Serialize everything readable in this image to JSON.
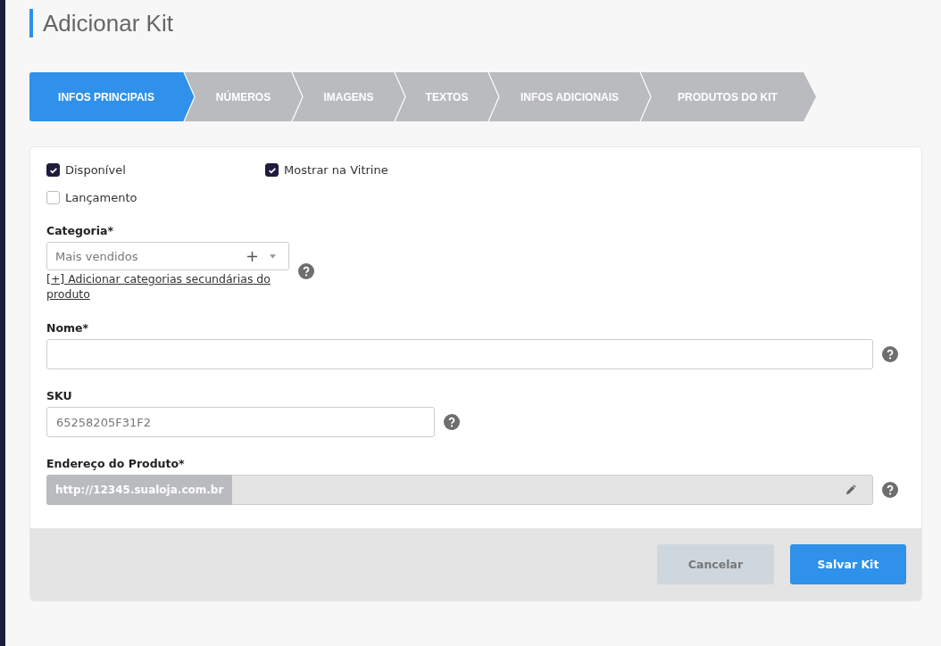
{
  "page_title": "Adicionar Kit",
  "steps": [
    {
      "label": "INFOS PRINCIPAIS",
      "selected": true
    },
    {
      "label": "NÚMEROS",
      "selected": false
    },
    {
      "label": "IMAGENS",
      "selected": false
    },
    {
      "label": "TEXTOS",
      "selected": false
    },
    {
      "label": "INFOS ADICIONAIS",
      "selected": false
    },
    {
      "label": "PRODUTOS DO KIT",
      "selected": false
    }
  ],
  "checkboxes": [
    {
      "label": "Disponível",
      "checked": true
    },
    {
      "label": "Mostrar na Vitrine",
      "checked": true
    },
    {
      "label": "Lançamento",
      "checked": false
    }
  ],
  "category": {
    "label": "Categoria*",
    "value": "Mais vendidos",
    "link": "[+] Adicionar categorias secundárias do produto"
  },
  "name": {
    "label": "Nome*"
  },
  "sku": {
    "label": "SKU",
    "value": "65258205F31F2"
  },
  "address": {
    "label": "Endereço do Produto*",
    "prefix": "http://12345.sualoja.com.br"
  },
  "buttons": {
    "cancel": "Cancelar",
    "save": "Salvar Kit"
  }
}
